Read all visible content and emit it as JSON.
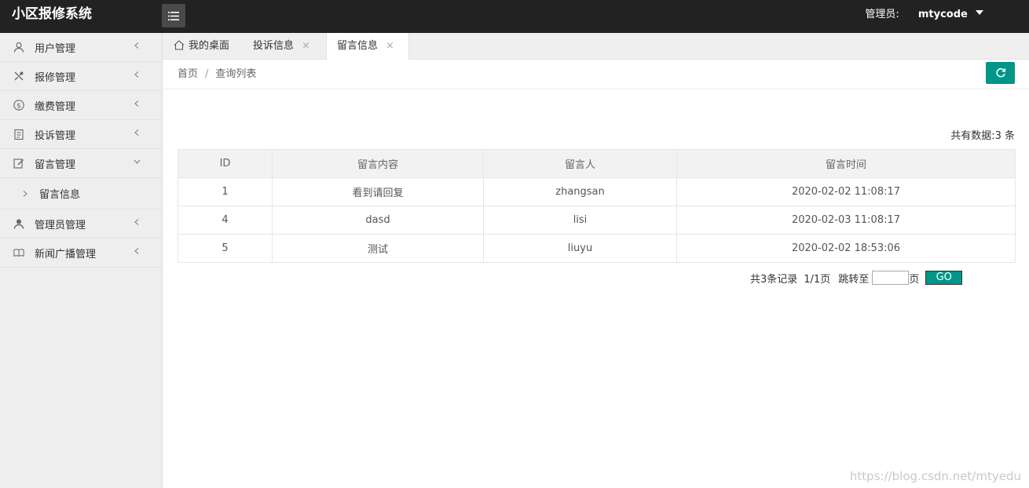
{
  "header": {
    "title": "小区报修系统",
    "admin_label": "管理员:",
    "username": "mtycode"
  },
  "sidebar": {
    "items": [
      {
        "label": "用户管理",
        "icon": "user-icon"
      },
      {
        "label": "报修管理",
        "icon": "tools-icon"
      },
      {
        "label": "缴费管理",
        "icon": "dollar-icon"
      },
      {
        "label": "投诉管理",
        "icon": "clipboard-icon"
      },
      {
        "label": "留言管理",
        "icon": "edit-icon",
        "expanded": true
      },
      {
        "label": "管理员管理",
        "icon": "admin-icon"
      },
      {
        "label": "新闻广播管理",
        "icon": "book-icon"
      }
    ],
    "sub_items": [
      {
        "label": "留言信息"
      }
    ]
  },
  "tabs": [
    {
      "label": "我的桌面"
    },
    {
      "label": "投诉信息",
      "close": "×"
    },
    {
      "label": "留言信息",
      "close": "×",
      "active": true
    }
  ],
  "breadcrumb": {
    "home": "首页",
    "separator": "/",
    "current": "查询列表"
  },
  "summary": "共有数据:3 条",
  "table": {
    "headers": [
      "ID",
      "留言内容",
      "留言人",
      "留言时间"
    ],
    "rows": [
      [
        "1",
        "看到请回复",
        "zhangsan",
        "2020-02-02 11:08:17"
      ],
      [
        "4",
        "dasd",
        "lisi",
        "2020-02-03 11:08:17"
      ],
      [
        "5",
        "测试",
        "liuyu",
        "2020-02-02 18:53:06"
      ]
    ]
  },
  "pager": {
    "records": "共3条记录",
    "pages": "1/1页",
    "jump_label": "跳转至",
    "page_unit": "页",
    "go_label": "GO",
    "input_value": ""
  },
  "watermark": "https://blog.csdn.net/mtyedu",
  "colors": {
    "header_bg": "#222222",
    "accent": "#009688",
    "sidebar_bg": "#eeeeee"
  }
}
